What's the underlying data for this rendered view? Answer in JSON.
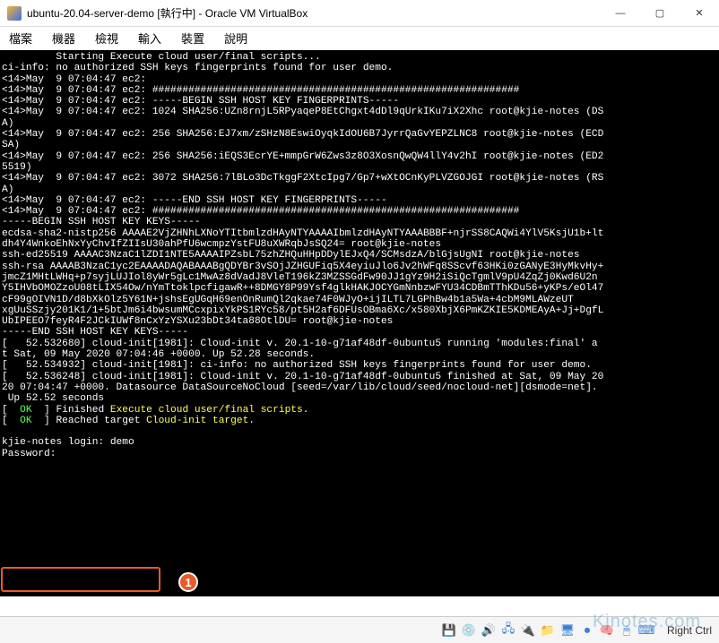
{
  "window": {
    "title": "ubuntu-20.04-server-demo [執行中] - Oracle VM VirtualBox"
  },
  "menu": {
    "file": "檔案",
    "machine": "機器",
    "view": "檢視",
    "input": "輸入",
    "devices": "裝置",
    "help": "說明"
  },
  "terminal": {
    "line01": "         Starting Execute cloud user/final scripts...",
    "line02": "ci-info: no authorized SSH keys fingerprints found for user demo.",
    "line03": "<14>May  9 07:04:47 ec2:",
    "line04": "<14>May  9 07:04:47 ec2: #############################################################",
    "line05": "<14>May  9 07:04:47 ec2: -----BEGIN SSH HOST KEY FINGERPRINTS-----",
    "line06": "<14>May  9 07:04:47 ec2: 1024 SHA256:UZn8rnjL5RPyaqeP8EtChgxt4dDl9qUrkIKu7iX2Xhc root@kjie-notes (DS",
    "line07": "A)",
    "line08": "<14>May  9 07:04:47 ec2: 256 SHA256:EJ7xm/zSHzN8EswiOyqkIdOU6B7JyrrQaGvYEPZLNC8 root@kjie-notes (ECD",
    "line09": "SA)",
    "line10": "<14>May  9 07:04:47 ec2: 256 SHA256:iEQS3EcrYE+mmpGrW6Zws3z8O3XosnQwQW4llY4v2hI root@kjie-notes (ED2",
    "line11": "5519)",
    "line12": "<14>May  9 07:04:47 ec2: 3072 SHA256:7lBLo3DcTkggF2XtcIpg7/Gp7+wXtOCnKyPLVZGOJGI root@kjie-notes (RS",
    "line13": "A)",
    "line14": "<14>May  9 07:04:47 ec2: -----END SSH HOST KEY FINGERPRINTS-----",
    "line15": "<14>May  9 07:04:47 ec2: #############################################################",
    "line16": "-----BEGIN SSH HOST KEY KEYS-----",
    "line17": "ecdsa-sha2-nistp256 AAAAE2VjZHNhLXNoYTItbmlzdHAyNTYAAAAIbmlzdHAyNTYAAABBBF+njrSS8CAQWi4YlV5KsjU1b+lt",
    "line18": "dh4Y4WnkoEhNxYyChvIfZIIsU30ahPfU6wcmpzYstFU8uXWRqbJsSQ24= root@kjie-notes",
    "line19": "ssh-ed25519 AAAAC3NzaC1lZDI1NTE5AAAAIPZsbL75zhZHQuHHpDDylEJxQ4/SCMsdzA/blGjsUgNI root@kjie-notes",
    "line20": "ssh-rsa AAAAB3NzaC1yc2EAAAADAQABAAABgQDYBr3vSOjJZHGUFiq5X4eyiuJlo6Jv2hWFq8SScvf63HKi0zGANyE3HyMkvHy+",
    "line21": "jmcZ1MHtLWHq+p7syjLUJIol8yWr5gLc1MwAz8dVadJ8VleT196kZ3MZSSGdFw90JJ1gYz9H2iSiQcTgmlV9pU4ZqZj0Kwd6U2n",
    "line22": "Y5IHVbOMOZzoU08tLIX54Ow/nYmTtoklpcfigawR++8DMGY8P99Ysf4glkHAKJOCYGmNnbzwFYU34CDBmTThKDu56+yKPs/eOl47",
    "line23": "cF99gOIVN1D/d8bXkOlz5Y61N+jshsEgUGqH69enOnRumQl2qkae74F0WJyO+ijILTL7LGPhBw4b1a5Wa+4cbM9MLAWzeUT",
    "line24": "xgUuSSzjy201K1/1+5btJm6i4bwsumMCcxpixYkPS1RYc58/pt5H2af6DFUsOBma6Xc/x580XbjX6PmKZKIE5KDMEAyA+Jj+DgfL",
    "line25": "UbIPEEO7feyR4F2JCkIUWf8nCxYzYSXu23bDt34ta88OtlDU= root@kjie-notes",
    "line26": "-----END SSH HOST KEY KEYS-----",
    "line27": "[   52.532680] cloud-init[1981]: Cloud-init v. 20.1-10-g71af48df-0ubuntu5 running 'modules:final' a",
    "line28": "t Sat, 09 May 2020 07:04:46 +0000. Up 52.28 seconds.",
    "line29": "[   52.534932] cloud-init[1981]: ci-info: no authorized SSH keys fingerprints found for user demo.",
    "line30": "[   52.536248] cloud-init[1981]: Cloud-init v. 20.1-10-g71af48df-0ubuntu5 finished at Sat, 09 May 20",
    "line31": "20 07:04:47 +0000. Datasource DataSourceNoCloud [seed=/var/lib/cloud/seed/nocloud-net][dsmode=net].",
    "line32": " Up 52.52 seconds",
    "ok1_a": "[  ",
    "ok1_b": "OK",
    "ok1_c": "  ] Finished ",
    "ok1_d": "Execute cloud user/final scripts",
    "ok1_e": ".",
    "ok2_a": "[  ",
    "ok2_b": "OK",
    "ok2_c": "  ] Reached target ",
    "ok2_d": "Cloud-init target",
    "ok2_e": ".",
    "blank": "",
    "login": "kjie-notes login: demo",
    "password": "Password:"
  },
  "callout": {
    "num": "1"
  },
  "statusbar": {
    "hostkey": "Right Ctrl"
  },
  "watermark": "Kjnotes.com"
}
